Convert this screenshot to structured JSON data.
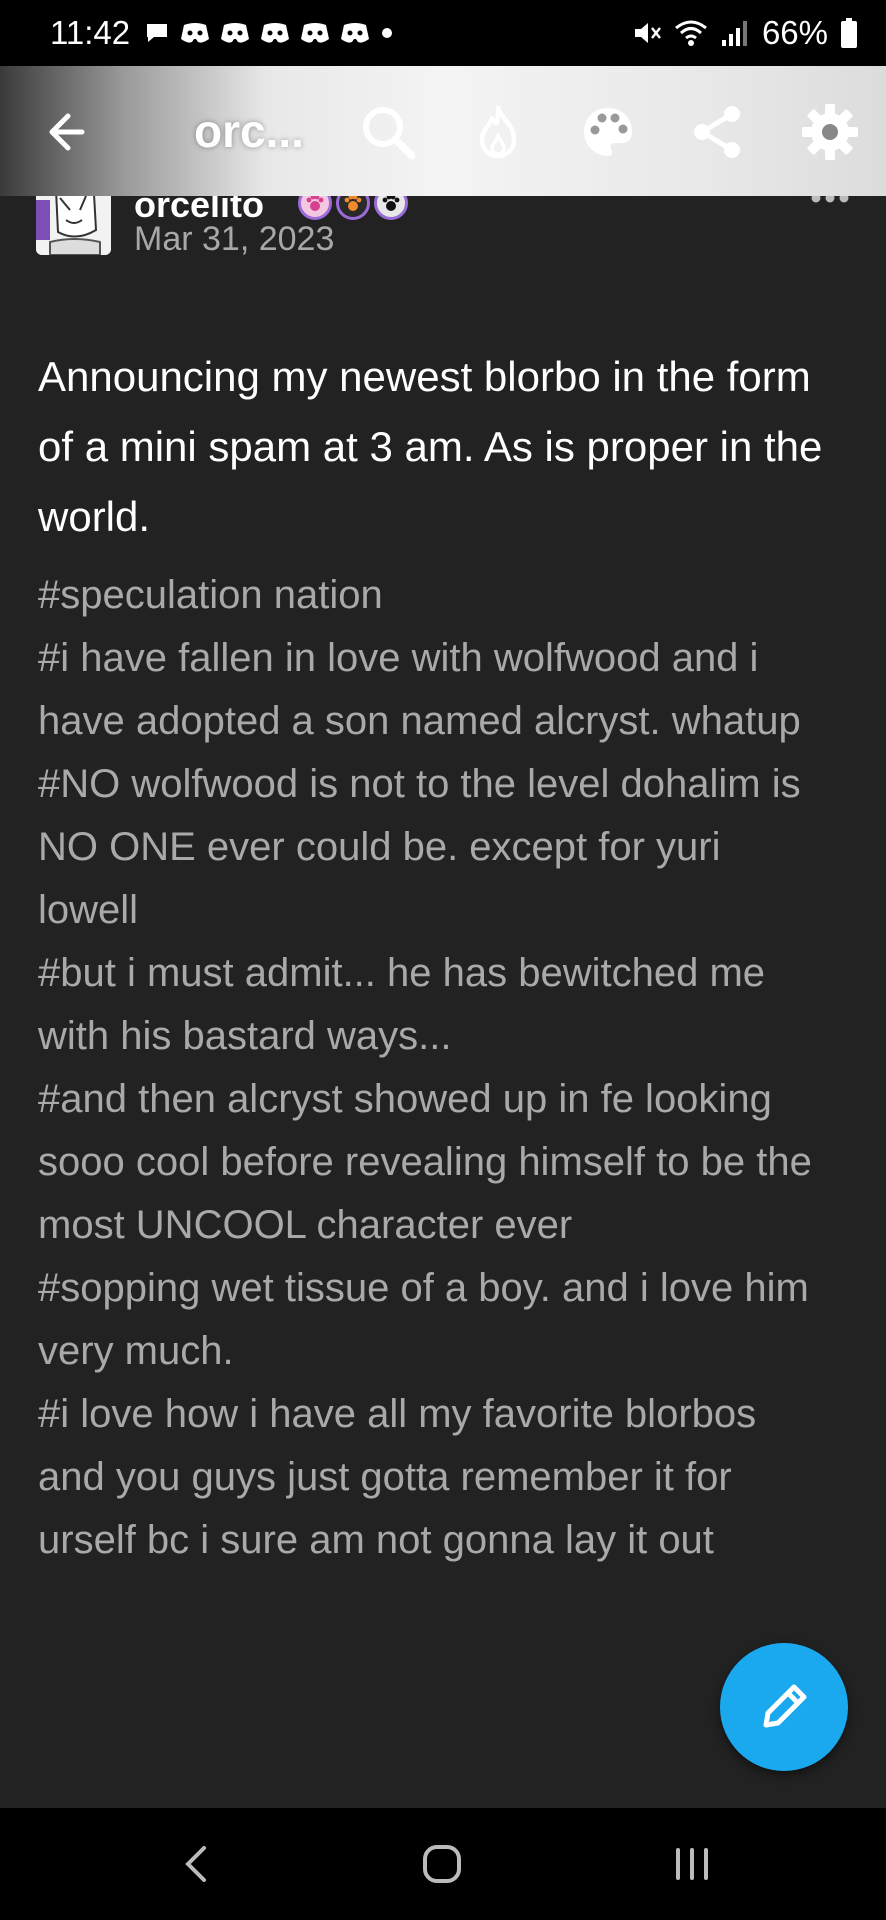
{
  "status_bar": {
    "time": "11:42",
    "battery_percent": "66%",
    "icons": [
      "chat-bubble-icon",
      "discord-icon",
      "discord-icon",
      "discord-icon",
      "discord-icon",
      "discord-icon",
      "dot-icon",
      "mute-icon",
      "wifi-icon",
      "signal-icon",
      "battery-icon"
    ]
  },
  "app_bar": {
    "title": "orc...",
    "actions": [
      "back-arrow-icon",
      "search-icon",
      "flame-icon",
      "palette-icon",
      "share-icon",
      "gear-icon"
    ]
  },
  "post": {
    "author": "orcelito",
    "date": "Mar 31, 2023",
    "badges": [
      "paw-badge-pink",
      "paw-badge-orange",
      "paw-badge-black"
    ],
    "body": "Announcing my newest blorbo in the form of a mini spam at 3 am. As is proper in the world.",
    "tags": [
      "#speculation nation",
      "#i have fallen in love with wolfwood and i have adopted a son named alcryst. whatup",
      "#NO wolfwood is not to the level dohalim is NO ONE ever could be. except for yuri lowell",
      "#but i must admit... he has bewitched me with his bastard ways...",
      "#and then alcryst showed up in fe looking sooo cool before revealing himself to be the most UNCOOL character ever",
      "#sopping wet tissue of a boy. and i love him very much.",
      "#i love how i have all my favorite blorbos and you guys just gotta remember it for urself bc i sure am not gonna lay it out"
    ]
  },
  "colors": {
    "background": "#222222",
    "tag_text": "#a9a9a9",
    "date_text": "#a8a8a8",
    "fab": "#1aa8ef",
    "badge_ring": "#9b6cd9"
  }
}
